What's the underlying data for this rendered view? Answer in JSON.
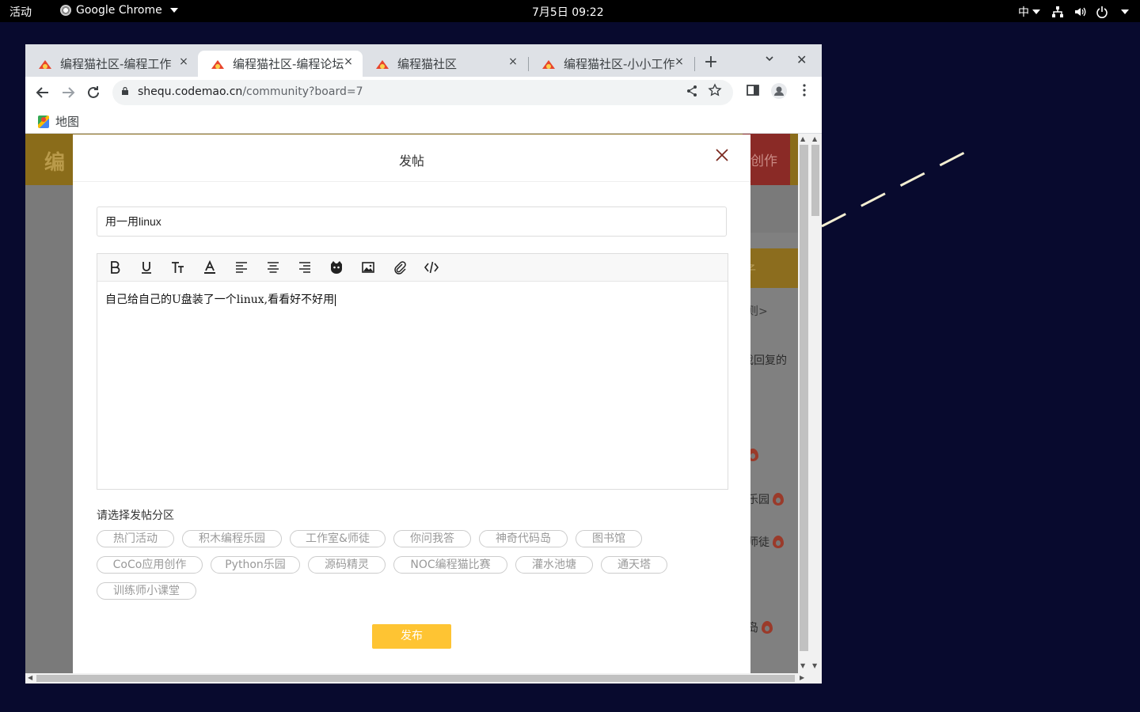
{
  "topbar": {
    "activities": "活动",
    "app_name": "Google Chrome",
    "clock": "7月5日  09:22",
    "input_method": "中"
  },
  "browser": {
    "tabs": [
      {
        "title": "编程猫社区-编程工作",
        "close": "×"
      },
      {
        "title": "编程猫社区-编程论坛",
        "close": "×"
      },
      {
        "title": "编程猫社区",
        "close": "×"
      },
      {
        "title": "编程猫社区-小小工作",
        "close": "×"
      }
    ],
    "new_tab": "+",
    "window_close": "✕",
    "url_domain": "shequ.codemao.cn",
    "url_path": "/community?board=7",
    "bookmarks": [
      {
        "label": "地图"
      }
    ]
  },
  "page": {
    "header_logo": "编",
    "header_create": "创作",
    "banner_text": "子",
    "side_rules": "则>",
    "side_my_replies": "我回复的",
    "side_hot": [
      "乐园",
      "师徒",
      "岛"
    ]
  },
  "modal": {
    "title": "发帖",
    "post_title_value": "用一用linux",
    "editor_content": "自己给自己的U盘装了一个linux,看看好不好用",
    "toolbar": [
      "bold-icon",
      "underline-icon",
      "text-size-icon",
      "font-color-icon",
      "align-left-icon",
      "align-center-icon",
      "align-right-icon",
      "cat-emoji-icon",
      "image-icon",
      "attachment-icon",
      "code-icon"
    ],
    "section_label": "请选择发帖分区",
    "boards": [
      "热门活动",
      "积木编程乐园",
      "工作室&师徒",
      "你问我答",
      "神奇代码岛",
      "图书馆",
      "CoCo应用创作",
      "Python乐园",
      "源码精灵",
      "NOC编程猫比赛",
      "灌水池塘",
      "通天塔",
      "训练师小课堂"
    ],
    "publish_label": "发布"
  },
  "colors": {
    "accent": "#fec433",
    "desktop": "#080a2e",
    "overlay": "#7a7a7a"
  }
}
